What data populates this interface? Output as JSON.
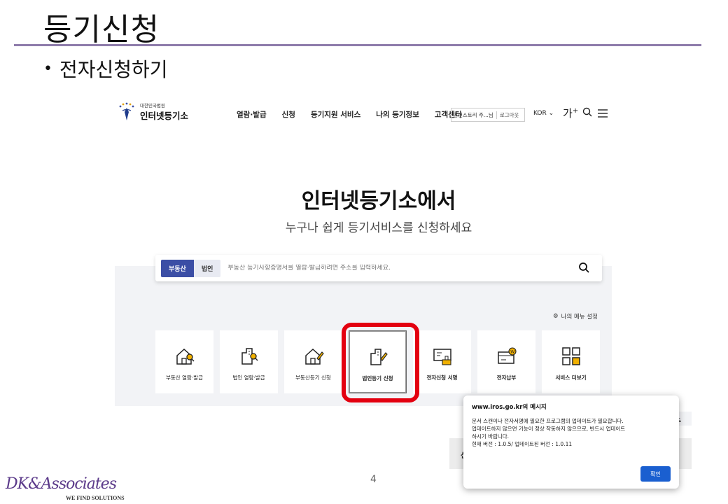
{
  "slide": {
    "title": "등기신청",
    "bullet": "전자신청하기",
    "page_number": "4",
    "footer_logo": "DK&Associates",
    "footer_tagline": "WE FIND SOLUTIONS"
  },
  "site_header": {
    "logo_small": "대한민국법원",
    "logo_big": "인터넷등기소",
    "nav": [
      "열람·발급",
      "신청",
      "등기지원 서비스",
      "나의 등기정보",
      "고객센터"
    ],
    "user_name": "인앤스토리 주...님",
    "logout": "로그아웃",
    "language": "KOR",
    "font_size": "가",
    "font_size_sup": "+"
  },
  "hero": {
    "title": "인터넷등기소에서",
    "subtitle": "누구나 쉽게 등기서비스를 신청하세요"
  },
  "search": {
    "tab_active": "부동산",
    "tab_inactive": "법인",
    "placeholder": "부동산 등기사항증명서를 열람·발급하려면 주소를 입력하세요."
  },
  "menu_setting": "나의 메뉴 설정",
  "tiles": [
    {
      "label": "부동산 열람·발급",
      "icon": "house-search-icon"
    },
    {
      "label": "법인 열람·발급",
      "icon": "building-search-icon"
    },
    {
      "label": "부동산등기 신청",
      "icon": "house-edit-icon"
    },
    {
      "label": "법인등기 신청",
      "icon": "building-edit-icon"
    },
    {
      "label": "전자신청 서명",
      "icon": "sign-icon"
    },
    {
      "label": "전자납부",
      "icon": "payment-icon"
    },
    {
      "label": "서비스 더보기",
      "icon": "grid-icon"
    }
  ],
  "background_fragment": "렌스",
  "background_fragment2": "신",
  "dialog": {
    "title": "www.iros.go.kr의 메시지",
    "lines": [
      "문서 스캔이나 전자서명에 필요한 프로그램의 업데이트가 필요합니다.",
      "업데이트하지 않으면 기능이 정상 작동하지 않으므로, 반드시 업데이트",
      "하시기 바랍니다.",
      "현재 버전 : 1.0.5/ 업데이트된 버전 : 1.0.11"
    ],
    "ok_label": "확인"
  },
  "colors": {
    "accent": "#3b4ea5",
    "highlight": "#e3000f",
    "ok_button": "#1a5fd0",
    "title_rule": "#8e7cab"
  }
}
